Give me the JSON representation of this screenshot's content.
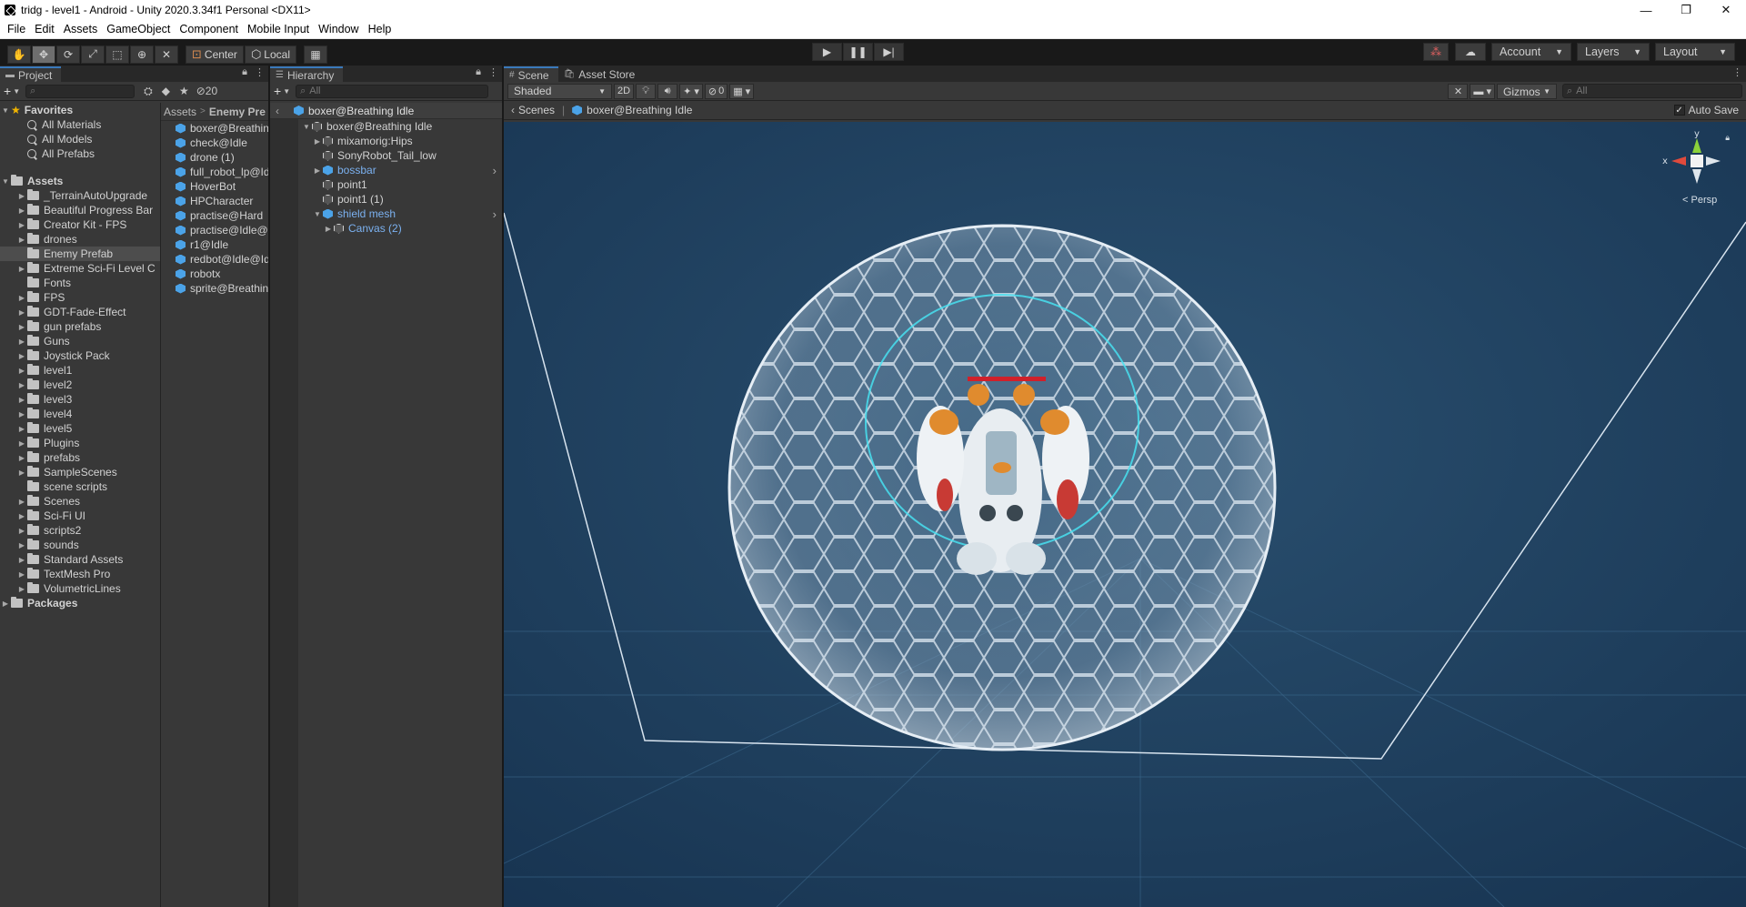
{
  "window": {
    "title": "tridg - level1 - Android - Unity 2020.3.34f1 Personal <DX11>",
    "minimize": "—",
    "maximize": "❐",
    "close": "✕"
  },
  "menu": [
    "File",
    "Edit",
    "Assets",
    "GameObject",
    "Component",
    "Mobile Input",
    "Window",
    "Help"
  ],
  "toolbar": {
    "pivot_mode": "Center",
    "pivot_rotation": "Local",
    "account_label": "Account",
    "layers_label": "Layers",
    "layout_label": "Layout"
  },
  "project": {
    "tab_label": "Project",
    "hidden_count": "20",
    "favorites_label": "Favorites",
    "favorites": [
      "All Materials",
      "All Models",
      "All Prefabs"
    ],
    "assets_label": "Assets",
    "folders": [
      "_TerrainAutoUpgrade",
      "Beautiful Progress Bar",
      "Creator Kit - FPS",
      "drones",
      "Enemy Prefab",
      "Extreme Sci-Fi Level C",
      "Fonts",
      "FPS",
      "GDT-Fade-Effect",
      "gun prefabs",
      "Guns",
      "Joystick Pack",
      "level1",
      "level2",
      "level3",
      "level4",
      "level5",
      "Plugins",
      "prefabs",
      "SampleScenes",
      "scene scripts",
      "Scenes",
      "Sci-Fi UI",
      "scripts2",
      "sounds",
      "Standard Assets",
      "TextMesh Pro",
      "VolumetricLines"
    ],
    "selected_folder": "Enemy Prefab",
    "packages_label": "Packages",
    "breadcrumb": [
      "Assets",
      "Enemy Pre"
    ],
    "files": [
      "boxer@Breathin",
      "check@Idle",
      "drone (1)",
      "full_robot_lp@Id",
      "HoverBot",
      "HPCharacter",
      "practise@Hard",
      "practise@Idle@",
      "r1@Idle",
      "redbot@Idle@Id",
      "robotx",
      "sprite@Breathin"
    ]
  },
  "hierarchy": {
    "tab_label": "Hierarchy",
    "search_placeholder": "All",
    "scene_title": "boxer@Breathing Idle",
    "root": "boxer@Breathing Idle",
    "items": [
      {
        "label": "mixamorig:Hips",
        "prefab": false
      },
      {
        "label": "SonyRobot_Tail_low",
        "prefab": false
      },
      {
        "label": "bossbar",
        "prefab": true
      },
      {
        "label": "point1",
        "prefab": false
      },
      {
        "label": "point1 (1)",
        "prefab": false
      },
      {
        "label": "shield mesh",
        "prefab": true
      }
    ],
    "child": "Canvas (2)"
  },
  "scene": {
    "tab_scene": "Scene",
    "tab_asset_store": "Asset Store",
    "shading_mode": "Shaded",
    "mode_2d": "2D",
    "hidden_count": "0",
    "gizmos_label": "Gizmos",
    "search_placeholder": "All",
    "crumb_root": "Scenes",
    "crumb_prefab": "boxer@Breathing Idle",
    "auto_save_label": "Auto Save",
    "auto_save": true,
    "projection": "Persp",
    "axis_x": "x",
    "axis_y": "y"
  },
  "colors": {
    "accent_tab": "#3a79bb",
    "prefab_blue": "#4ba3e8",
    "viewport_bg": "#1f3b57"
  }
}
